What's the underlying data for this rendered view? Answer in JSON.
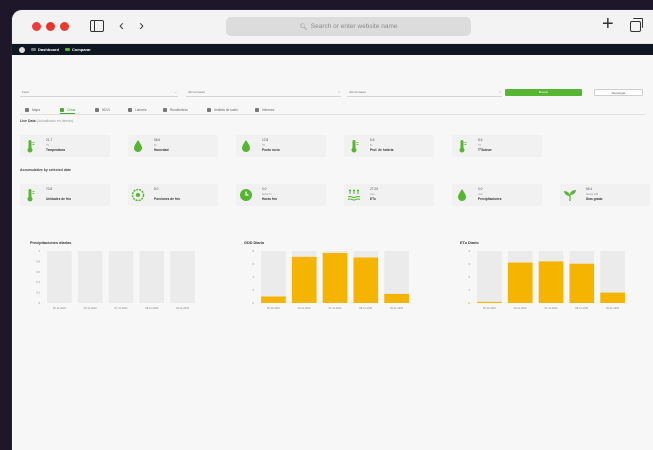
{
  "browser": {
    "url_placeholder": "Search or enter website name",
    "icons": [
      "sidebar-icon",
      "back-icon",
      "forward-icon",
      "search-icon",
      "new-tab-icon",
      "tabs-overview-icon"
    ]
  },
  "app_header": {
    "dashboard_label": "Dashboard",
    "compare_label": "Comparar",
    "compare_color": "#57b534"
  },
  "filters": {
    "field1": "Field",
    "date_from": "dd/mm/aaaa",
    "date_to": "dd/mm/aaaa",
    "search_label": "Buscar",
    "download_label": "Descargar",
    "search_color": "#57b534"
  },
  "tabs": [
    {
      "label": "Mapa",
      "active": false
    },
    {
      "label": "Clima",
      "active": true
    },
    {
      "label": "NDVI",
      "active": false
    },
    {
      "label": "Labores",
      "active": false
    },
    {
      "label": "Rendimiento",
      "active": false
    },
    {
      "label": "Análisis de suelo",
      "active": false
    },
    {
      "label": "Informes",
      "active": false
    }
  ],
  "live_data": {
    "title": "Live Data",
    "subtitle": "(Actualizado en directo)",
    "cards": [
      {
        "icon": "thermometer-icon",
        "value": "21.7",
        "unit": "°C",
        "label": "Temperatura"
      },
      {
        "icon": "humidity-drop-icon",
        "value": "56.6",
        "unit": "%",
        "label": "Humedad"
      },
      {
        "icon": "dew-point-icon",
        "value": "12.8",
        "unit": "°C",
        "label": "Punto rocío"
      },
      {
        "icon": "soil-depth-thermometer-icon",
        "value": "5.6",
        "unit": "%",
        "label": "Prof. de hoteria"
      },
      {
        "icon": "soil-thermometer-icon",
        "value": "8.6",
        "unit": "°C",
        "label": "T°Subsw"
      }
    ]
  },
  "accumulated": {
    "title": "Accumulative by selected date",
    "cards": [
      {
        "icon": "thermometer-icon",
        "value": "70.8",
        "unit": "",
        "label": "Unidades de frío"
      },
      {
        "icon": "chill-hours-icon",
        "value": "8.0",
        "unit": "",
        "label": "Porciones de frío"
      },
      {
        "icon": "clock-icon",
        "value": "0.0",
        "unit": "hora °C",
        "label": "Horas frío"
      },
      {
        "icon": "evapotranspiration-icon",
        "value": "27.25",
        "unit": "mm",
        "label": "ETo"
      },
      {
        "icon": "rain-drop-icon",
        "value": "0.0",
        "unit": "mm",
        "label": "Precipitaciones"
      },
      {
        "icon": "sprout-icon",
        "value": "66.4",
        "unit": "horas GD",
        "label": "Días grado"
      }
    ]
  },
  "chart_data": [
    {
      "type": "bar",
      "title": "Precipitaciones diarias",
      "categories": [
        "05-11-2022",
        "06-11-2022",
        "07-11-2022",
        "08-11-2022",
        "09-11-2022"
      ],
      "values": [
        0,
        0,
        0,
        0,
        0
      ],
      "ylim": [
        0,
        1
      ],
      "yticks": [
        "1",
        "0.8",
        "0.6",
        "0.4",
        "0.2",
        "0"
      ],
      "bar_color": "#f5b400",
      "background_bar_color": "#ebebeb"
    },
    {
      "type": "bar",
      "title": "GDD Diario",
      "categories": [
        "05-11-2022",
        "06-11-2022",
        "07-11-2022",
        "08-11-2022",
        "09-11-2022"
      ],
      "values": [
        1,
        7.1,
        7.7,
        7,
        1.4
      ],
      "ylim": [
        0,
        8
      ],
      "yticks": [
        "8",
        "6",
        "4",
        "2",
        "0"
      ],
      "bar_color": "#f5b400",
      "background_bar_color": "#ebebeb"
    },
    {
      "type": "bar",
      "title": "ETo Diario",
      "categories": [
        "05-11-2022",
        "06-11-2022",
        "07-11-2022",
        "08-11-2022",
        "09-11-2022"
      ],
      "values": [
        0.1,
        3.5,
        3.6,
        3.4,
        0.9
      ],
      "ylim": [
        0,
        4.5
      ],
      "yticks": [
        "4",
        "3",
        "2",
        "1",
        "0"
      ],
      "bar_color": "#f5b400",
      "background_bar_color": "#ebebeb"
    }
  ]
}
